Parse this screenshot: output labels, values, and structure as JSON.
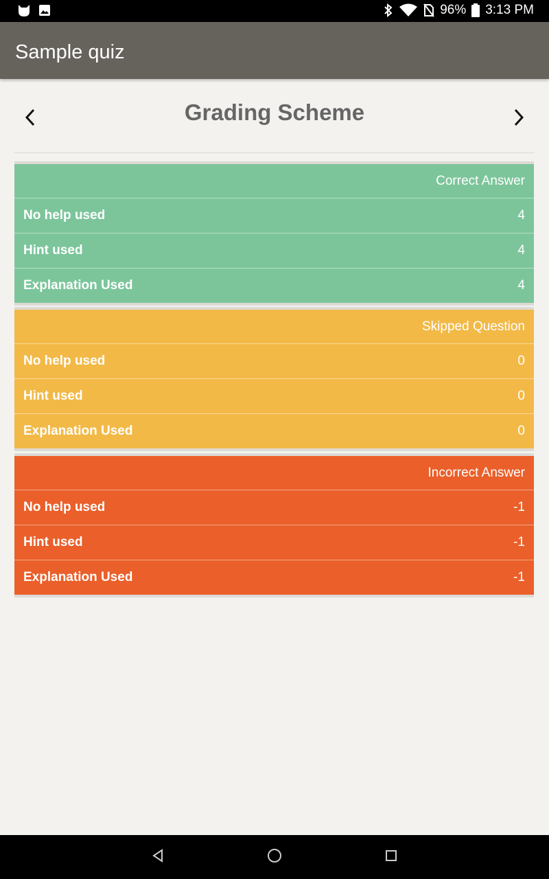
{
  "status_bar": {
    "battery": "96%",
    "time": "3:13 PM",
    "icons": [
      "cat-icon",
      "image-icon",
      "bluetooth-icon",
      "wifi-icon",
      "no-sim-icon",
      "battery-icon"
    ]
  },
  "app_bar": {
    "title": "Sample quiz"
  },
  "header": {
    "title": "Grading Scheme",
    "prev_icon": "chevron-left-icon",
    "next_icon": "chevron-right-icon"
  },
  "colors": {
    "correct": "#7cc59b",
    "skipped": "#f2b947",
    "incorrect": "#ea5f2a",
    "app_bar": "#66625c",
    "background": "#f3f2ef"
  },
  "groups": [
    {
      "title": "Correct Answer",
      "rows": [
        {
          "label": "No help used",
          "value": "4"
        },
        {
          "label": "Hint used",
          "value": "4"
        },
        {
          "label": "Explanation Used",
          "value": "4"
        }
      ]
    },
    {
      "title": "Skipped Question",
      "rows": [
        {
          "label": "No help used",
          "value": "0"
        },
        {
          "label": "Hint used",
          "value": "0"
        },
        {
          "label": "Explanation Used",
          "value": "0"
        }
      ]
    },
    {
      "title": "Incorrect Answer",
      "rows": [
        {
          "label": "No help used",
          "value": "-1"
        },
        {
          "label": "Hint used",
          "value": "-1"
        },
        {
          "label": "Explanation Used",
          "value": "-1"
        }
      ]
    }
  ],
  "system_nav": {
    "icons": [
      "back-triangle-icon",
      "home-circle-icon",
      "recents-square-icon"
    ]
  }
}
